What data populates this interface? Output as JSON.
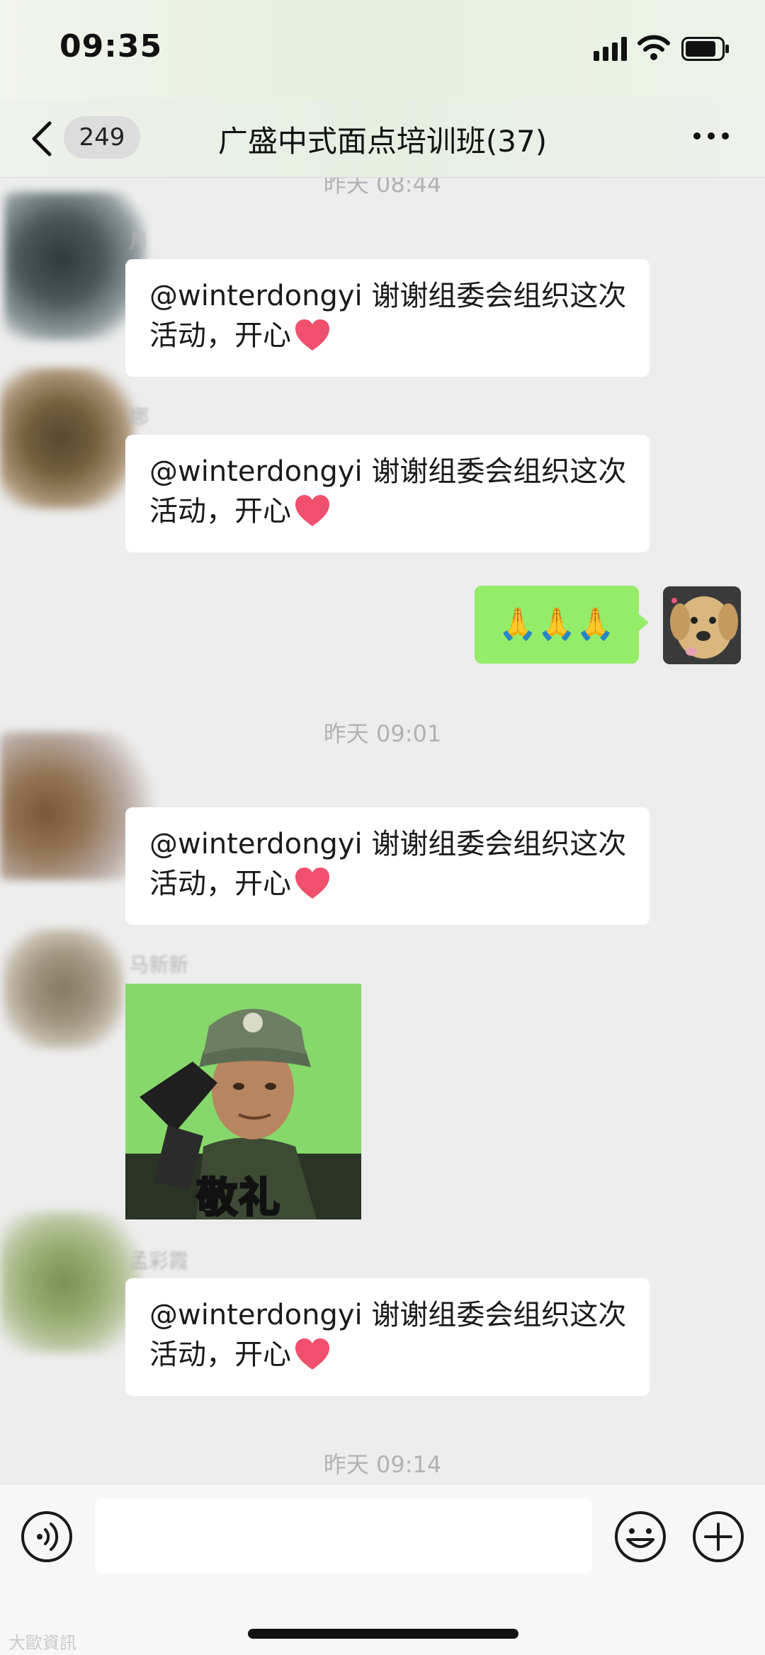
{
  "status_bar": {
    "time": "09:35"
  },
  "nav": {
    "unread_count": "249",
    "title": "广盛中式面点培训班(37)"
  },
  "timestamps": [
    "昨天 08:44",
    "昨天 09:01",
    "昨天 09:14"
  ],
  "messages": [
    {
      "sender": "月",
      "text": "@winterdongyi 谢谢组委会组织这次活动，开心"
    },
    {
      "sender": "娜",
      "text": "@winterdongyi 谢谢组委会组织这次活动，开心"
    },
    {
      "self_text": "🙏🙏🙏"
    },
    {
      "sender": "",
      "text": "@winterdongyi 谢谢组委会组织这次活动，开心"
    },
    {
      "sender": "马新新",
      "sticker_text": "敬礼"
    },
    {
      "sender": "孟彩霞",
      "text": "@winterdongyi 谢谢组委会组织这次活动，开心"
    }
  ],
  "input": {
    "placeholder": ""
  },
  "watermark": "大歐資訊",
  "colors": {
    "self_bubble": "#95ec69",
    "other_bubble": "#ffffff",
    "background": "#ededed",
    "heart": "#f0506e"
  },
  "icons": [
    "signal-icon",
    "wifi-icon",
    "battery-icon",
    "back-icon",
    "more-icon",
    "heart-icon",
    "voice-icon",
    "emoji-icon",
    "plus-icon"
  ]
}
